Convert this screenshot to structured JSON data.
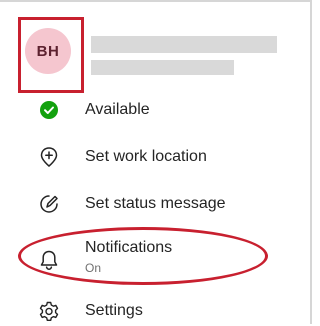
{
  "profile": {
    "initials": "BH",
    "avatar_color": "#f5c6cf"
  },
  "menu": {
    "items": [
      {
        "label": "Available",
        "icon": "status-available-icon"
      },
      {
        "label": "Set work location",
        "icon": "location-plus-icon"
      },
      {
        "label": "Set status message",
        "icon": "edit-status-icon"
      },
      {
        "label": "Notifications",
        "sublabel": "On",
        "icon": "bell-icon"
      },
      {
        "label": "Settings",
        "icon": "gear-icon"
      }
    ]
  },
  "colors": {
    "annotation": "#c8202f",
    "available_green": "#13a10e"
  }
}
